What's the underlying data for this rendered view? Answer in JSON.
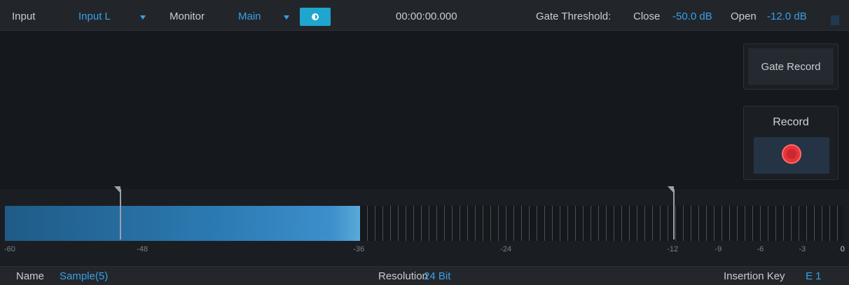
{
  "topbar": {
    "input_label": "Input",
    "input_value": "Input L",
    "monitor_label": "Monitor",
    "monitor_value": "Main",
    "timecode": "00:00:00.000",
    "gate_threshold_label": "Gate Threshold:",
    "close_label": "Close",
    "close_value": "-50.0 dB",
    "open_label": "Open",
    "open_value": "-12.0 dB"
  },
  "buttons": {
    "gate_record": "Gate Record",
    "record": "Record"
  },
  "meter": {
    "level_db": -36,
    "range_db": [
      -60,
      0
    ],
    "close_threshold_db": -50,
    "open_threshold_db": -12,
    "scale_labels": [
      "-60",
      "-48",
      "-36",
      "-24",
      "-12",
      "-9",
      "-6",
      "-3",
      "0"
    ]
  },
  "bottombar": {
    "name_label": "Name",
    "name_value": "Sample(5)",
    "resolution_label": "Resolution",
    "resolution_value": "24 Bit",
    "insertion_key_label": "Insertion Key",
    "insertion_key_value": "E 1"
  },
  "colors": {
    "accent": "#3aa0e8",
    "monitor_button": "#1ea6cf",
    "record": "#e8333a"
  }
}
